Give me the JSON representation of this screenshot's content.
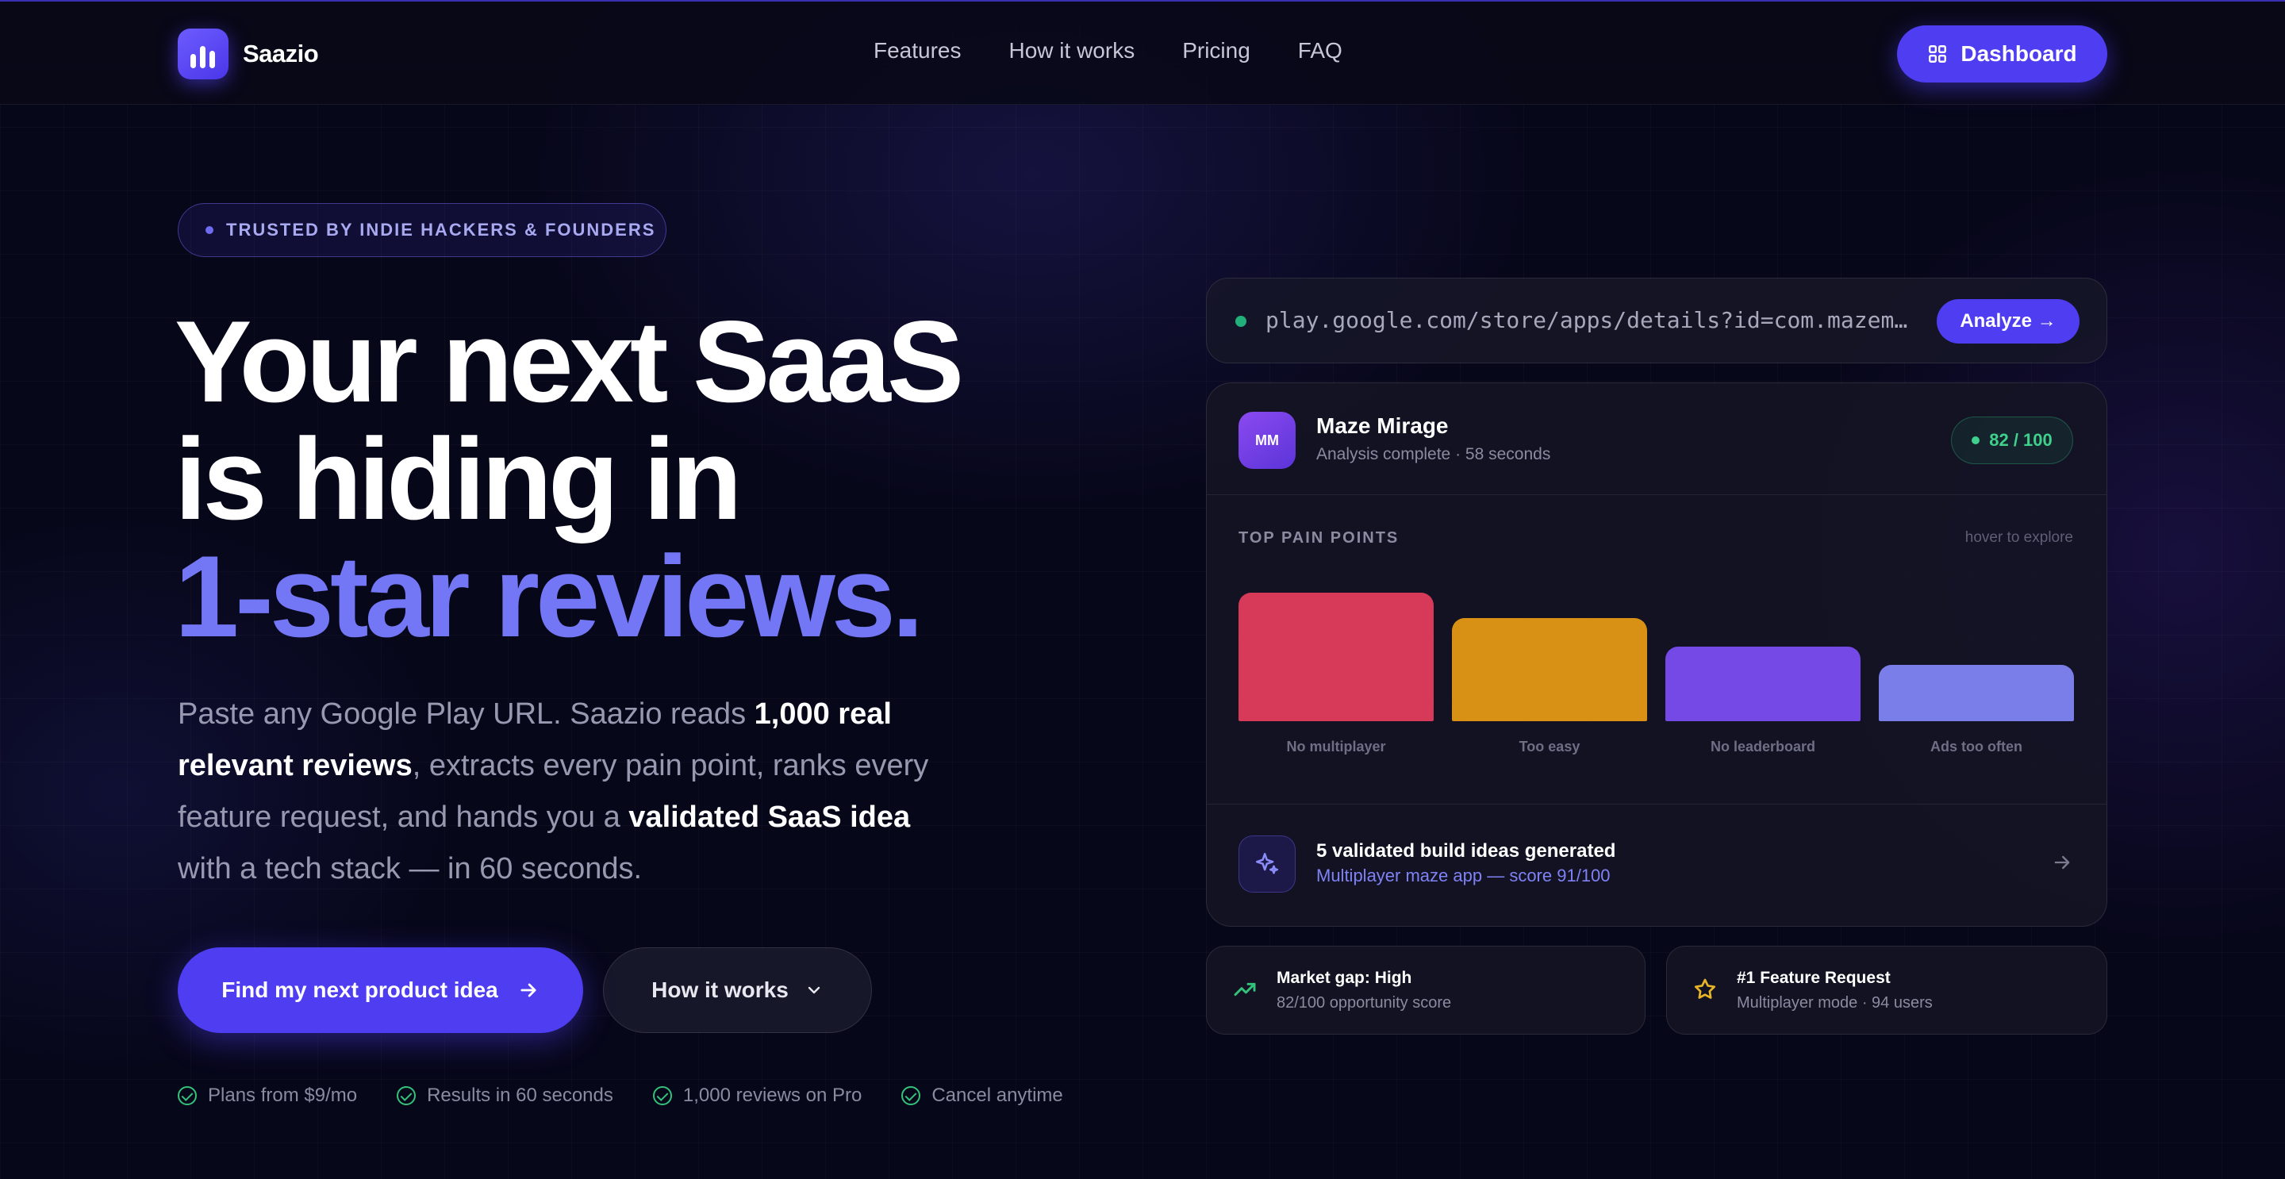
{
  "brand": {
    "name": "Saazio"
  },
  "nav": {
    "links": [
      "Features",
      "How it works",
      "Pricing",
      "FAQ"
    ],
    "dashboard_label": "Dashboard"
  },
  "hero": {
    "badge": "TRUSTED BY INDIE HACKERS & FOUNDERS",
    "headline_line1": "Your next SaaS",
    "headline_line2": "is hiding in",
    "headline_accent": "1-star reviews.",
    "sub_part1": "Paste any Google Play URL. Saazio reads ",
    "sub_bold1": "1,000 real relevant reviews",
    "sub_part2": ", extracts every pain point, ranks every feature request, and hands you a ",
    "sub_bold2": "validated SaaS idea",
    "sub_part3": " with a tech stack — in 60 seconds.",
    "cta_primary": "Find my next product idea",
    "cta_secondary": "How it works",
    "checks": [
      "Plans from $9/mo",
      "Results in 60 seconds",
      "1,000 reviews on Pro",
      "Cancel anytime"
    ]
  },
  "demo": {
    "url": "play.google.com/store/apps/details?id=com.mazemirage.game",
    "analyze_label": "Analyze →",
    "app": {
      "initials": "MM",
      "name": "Maze Mirage",
      "meta": "Analysis complete · 58 seconds",
      "score": "82 / 100"
    },
    "pain_points_title": "TOP PAIN POINTS",
    "pain_points_hint": "hover to explore",
    "ideas_title": "5 validated build ideas generated",
    "ideas_sub": "Multiplayer maze app — score 91/100"
  },
  "chart_data": {
    "type": "bar",
    "categories": [
      "No multiplayer",
      "Too easy",
      "No leaderboard",
      "Ads too often"
    ],
    "values": [
      100,
      80,
      58,
      44
    ],
    "ylim": [
      0,
      100
    ],
    "colors": [
      "#d63a58",
      "#d99115",
      "#7549e6",
      "#7a7ee8"
    ],
    "grid": false
  },
  "mini_cards": [
    {
      "title": "Market gap: High",
      "sub": "82/100 opportunity score",
      "icon": "trending-up-icon",
      "color": "#34c27a"
    },
    {
      "title": "#1 Feature Request",
      "sub": "Multiplayer mode · 94 users",
      "icon": "star-icon",
      "color": "#e8b526"
    }
  ]
}
